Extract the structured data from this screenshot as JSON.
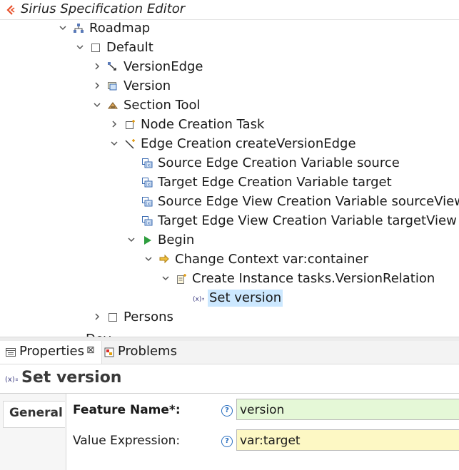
{
  "editor": {
    "title": "Sirius Specification Editor",
    "tree": [
      {
        "label": "Roadmap",
        "icon": "diagram-icon",
        "depth": 0,
        "toggle": "expanded"
      },
      {
        "label": "Default",
        "icon": "layer-icon",
        "depth": 1,
        "toggle": "expanded"
      },
      {
        "label": "VersionEdge",
        "icon": "edge-mapping-icon",
        "depth": 2,
        "toggle": "collapsed"
      },
      {
        "label": "Version",
        "icon": "node-mapping-icon",
        "depth": 2,
        "toggle": "collapsed"
      },
      {
        "label": "Section Tool",
        "icon": "tool-section-icon",
        "depth": 2,
        "toggle": "expanded"
      },
      {
        "label": "Node Creation Task",
        "icon": "node-creation-icon",
        "depth": 3,
        "toggle": "collapsed"
      },
      {
        "label": "Edge Creation createVersionEdge",
        "icon": "edge-creation-icon",
        "depth": 3,
        "toggle": "expanded"
      },
      {
        "label": "Source Edge Creation Variable source",
        "icon": "variable-icon",
        "depth": 4,
        "toggle": "none"
      },
      {
        "label": "Target Edge Creation Variable target",
        "icon": "variable-icon",
        "depth": 4,
        "toggle": "none"
      },
      {
        "label": "Source Edge View Creation Variable sourceView",
        "icon": "variable-icon",
        "depth": 4,
        "toggle": "none"
      },
      {
        "label": "Target Edge View Creation Variable targetView",
        "icon": "variable-icon",
        "depth": 4,
        "toggle": "none"
      },
      {
        "label": "Begin",
        "icon": "begin-icon",
        "depth": 4,
        "toggle": "expanded"
      },
      {
        "label": "Change Context var:container",
        "icon": "change-context-icon",
        "depth": 5,
        "toggle": "expanded"
      },
      {
        "label": "Create Instance tasks.VersionRelation",
        "icon": "create-instance-icon",
        "depth": 6,
        "toggle": "expanded"
      },
      {
        "label": "Set version",
        "icon": "set-value-icon",
        "depth": 7,
        "toggle": "none",
        "selected": true
      },
      {
        "label": "Persons",
        "icon": "layer-icon",
        "depth": 2,
        "toggle": "collapsed"
      }
    ],
    "cutoff_label": "Dev"
  },
  "views": {
    "tabs": [
      {
        "label": "Properties",
        "icon": "properties-icon",
        "active": true,
        "closable": true
      },
      {
        "label": "Problems",
        "icon": "problems-icon",
        "active": false
      }
    ],
    "close_glyph": "⊠",
    "header": {
      "icon": "set-value-icon",
      "title": "Set version"
    },
    "side_tab": "General",
    "help_glyph": "?",
    "fields": [
      {
        "label": "Feature Name*:",
        "value": "version",
        "required": true,
        "bg": "#e5f8d7"
      },
      {
        "label": "Value Expression:",
        "value": "var:target",
        "required": false,
        "bg": "#fdf8c4"
      }
    ]
  },
  "colors": {
    "selection": "#cce8ff",
    "accent": "#2a6fbf",
    "begin": "#2e9e3e",
    "sirius": "#e8502a"
  }
}
